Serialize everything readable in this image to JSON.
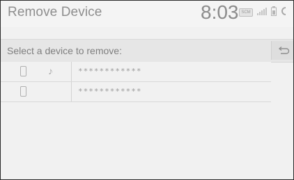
{
  "header": {
    "title": "Remove Device",
    "clock": "8:03",
    "badge_text": "SCM"
  },
  "subheader": {
    "prompt": "Select a device to remove:"
  },
  "devices": [
    {
      "name": "************",
      "phone_icon": "phone-icon",
      "audio_icon": "music-note-icon",
      "audio_symbol": "♪"
    },
    {
      "name": "************",
      "phone_icon": "phone-icon"
    }
  ],
  "colors": {
    "background": "#f1f1f1",
    "header_text": "#8e8e8e",
    "subheader_bg": "#e6e6e6"
  }
}
